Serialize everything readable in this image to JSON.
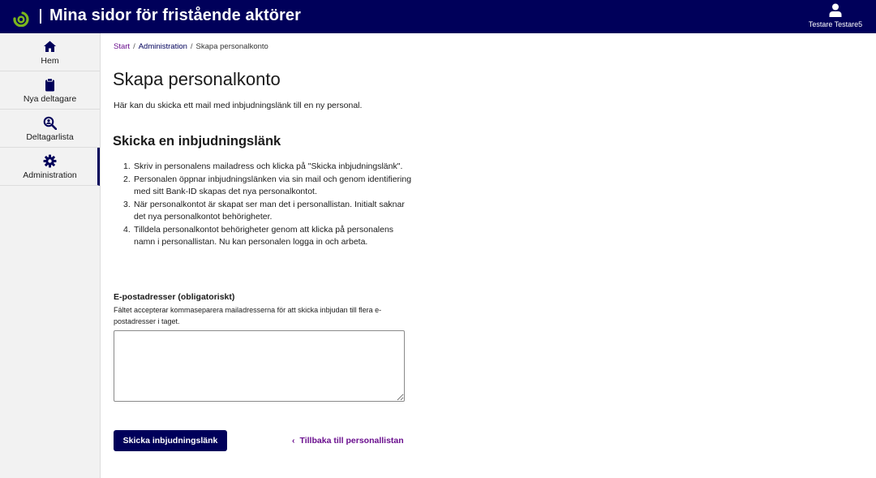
{
  "header": {
    "app_title": "Mina sidor för fristående aktörer",
    "user_name": "Testare Testare5",
    "brand_color": "#00005a",
    "logo_color": "#7ab51d"
  },
  "sidebar": {
    "items": [
      {
        "label": "Hem",
        "icon": "home-icon",
        "active": false
      },
      {
        "label": "Nya deltagare",
        "icon": "clipboard-icon",
        "active": false
      },
      {
        "label": "Deltagarlista",
        "icon": "search-user-icon",
        "active": false
      },
      {
        "label": "Administration",
        "icon": "gear-icon",
        "active": true
      }
    ]
  },
  "breadcrumb": {
    "start": "Start",
    "admin": "Administration",
    "current": "Skapa personalkonto",
    "separator": "/"
  },
  "main": {
    "title": "Skapa personalkonto",
    "intro": "Här kan du skicka ett mail med inbjudningslänk till en ny personal.",
    "section_title": "Skicka en inbjudningslänk",
    "steps": [
      {
        "num": "1.",
        "text": "Skriv in personalens mailadress och klicka på \"Skicka inbjudningslänk\"."
      },
      {
        "num": "2.",
        "text": "Personalen öppnar inbjudningslänken via sin mail och genom identifiering med sitt Bank-ID skapas det nya personalkontot."
      },
      {
        "num": "3.",
        "text": "När personalkontot är skapat ser man det i personallistan. Initialt saknar det nya personalkontot behörigheter."
      },
      {
        "num": "4.",
        "text": "Tilldela personalkontot behörigheter genom att klicka på personalens namn i personallistan. Nu kan personalen logga in och arbeta."
      }
    ],
    "email_label": "E-postadresser (obligatoriskt)",
    "email_help": "Fältet accepterar kommaseparera mailadresserna för att skicka inbjudan till flera e-postadresser i taget.",
    "email_value": "",
    "send_button": "Skicka inbjudningslänk",
    "back_link": "Tillbaka till personallistan",
    "link_color": "#6a0f8e"
  }
}
